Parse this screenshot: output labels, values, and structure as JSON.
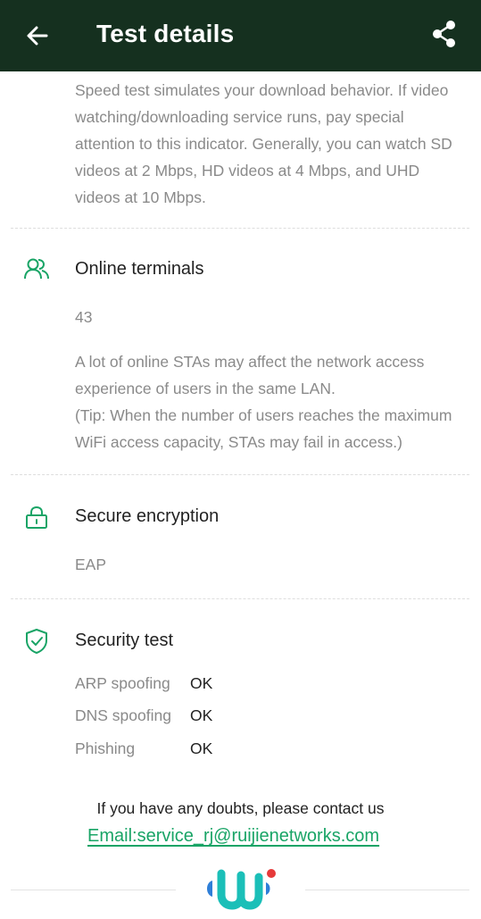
{
  "header": {
    "title": "Test details",
    "back_icon": "arrow-left-icon",
    "share_icon": "share-icon"
  },
  "speed_section": {
    "description": "Speed test simulates your download behavior. If video watching/downloading service runs, pay special attention to this indicator. Generally, you can watch SD videos at 2 Mbps, HD videos at 4 Mbps, and UHD videos at 10 Mbps."
  },
  "terminals_section": {
    "icon": "users-icon",
    "title": "Online terminals",
    "value": "43",
    "description_line1": "A lot of online STAs may affect the network access experience of users in the same LAN.",
    "description_line2": "(Tip: When the number of users reaches the maximum WiFi access capacity, STAs may fail in access.)"
  },
  "encryption_section": {
    "icon": "lock-icon",
    "title": "Secure encryption",
    "value": "EAP"
  },
  "security_section": {
    "icon": "shield-check-icon",
    "title": "Security test",
    "rows": [
      {
        "label": "ARP spoofing",
        "value": "OK"
      },
      {
        "label": "DNS spoofing",
        "value": "OK"
      },
      {
        "label": "Phishing",
        "value": "OK"
      }
    ]
  },
  "footer": {
    "contact_text": "If you have any doubts, please contact us",
    "email_text": "Email:service_rj@ruijienetworks.com",
    "logo": "wi-logo"
  },
  "colors": {
    "header_bg": "#15301f",
    "accent_green": "#19a466",
    "muted_text": "#8a8a8a",
    "logo_blue": "#2f7fd8",
    "logo_teal": "#1bbfb8",
    "logo_red": "#e63a3a"
  }
}
